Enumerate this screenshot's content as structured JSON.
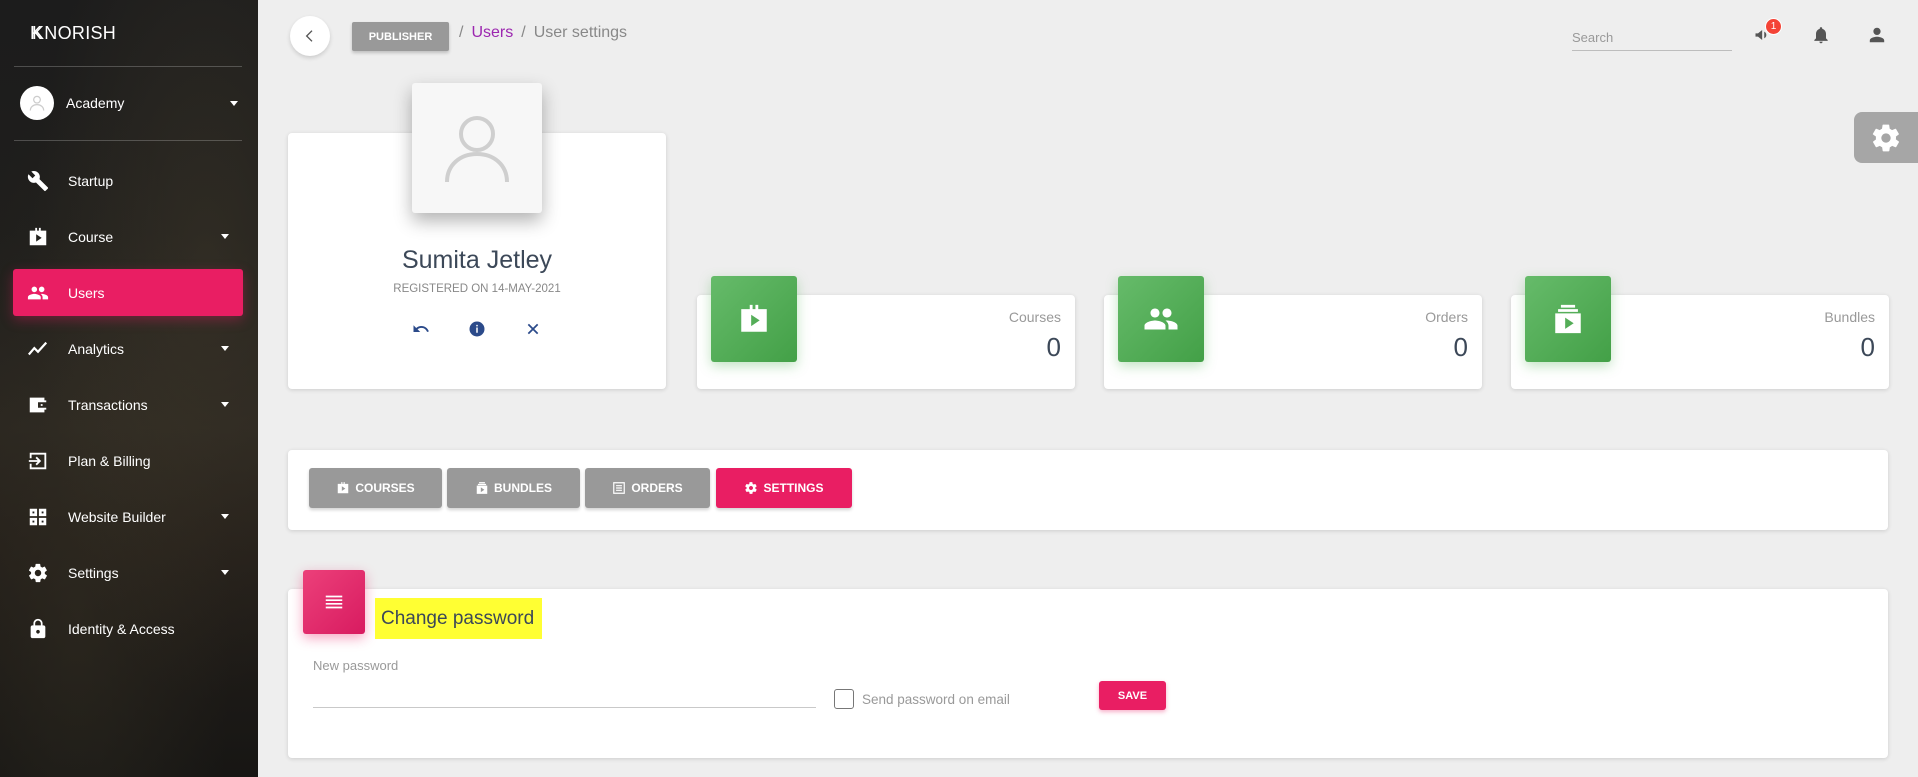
{
  "brand": {
    "mini": "K",
    "name": "KNORISH"
  },
  "sidebar": {
    "user_label": "Academy",
    "items": [
      {
        "label": "Startup",
        "icon": "wrench-icon",
        "caret": false,
        "active": false
      },
      {
        "label": "Course",
        "icon": "course-case-icon",
        "caret": true,
        "active": false
      },
      {
        "label": "Users",
        "icon": "users-icon",
        "caret": false,
        "active": true
      },
      {
        "label": "Analytics",
        "icon": "trending-line-icon",
        "caret": true,
        "active": false
      },
      {
        "label": "Transactions",
        "icon": "wallet-icon",
        "caret": true,
        "active": false
      },
      {
        "label": "Plan & Billing",
        "icon": "login-arrow-icon",
        "caret": false,
        "active": false
      },
      {
        "label": "Website Builder",
        "icon": "grid-builder-icon",
        "caret": true,
        "active": false
      },
      {
        "label": "Settings",
        "icon": "gear-icon",
        "caret": true,
        "active": false
      },
      {
        "label": "Identity & Access",
        "icon": "lock-icon",
        "caret": false,
        "active": false
      }
    ]
  },
  "topbar": {
    "badge": "PUBLISHER",
    "breadcrumb": {
      "link": "Users",
      "current": "User settings",
      "sep": "/"
    },
    "search_placeholder": "Search",
    "notification_count": "1"
  },
  "profile": {
    "name": "Sumita Jetley",
    "registered": "REGISTERED ON 14-MAY-2021"
  },
  "stats": [
    {
      "label": "Courses",
      "value": "0",
      "icon": "course-case-icon"
    },
    {
      "label": "Orders",
      "value": "0",
      "icon": "users-icon"
    },
    {
      "label": "Bundles",
      "value": "0",
      "icon": "bundle-icon"
    }
  ],
  "tabs": [
    {
      "label": "COURSES",
      "icon": "course-case-icon",
      "active": false
    },
    {
      "label": "BUNDLES",
      "icon": "bundle-icon",
      "active": false
    },
    {
      "label": "ORDERS",
      "icon": "list-icon",
      "active": false
    },
    {
      "label": "SETTINGS",
      "icon": "gear-icon",
      "active": true
    }
  ],
  "password": {
    "title": "Change password",
    "field_label": "New password",
    "value": "",
    "checkbox_label": "Send password on email",
    "checked": false,
    "save_label": "SAVE"
  },
  "colors": {
    "accent": "#e91e63",
    "green": "#4caf50",
    "grey_btn": "#999999",
    "highlight": "#ffff33",
    "link": "#9c27b0"
  }
}
